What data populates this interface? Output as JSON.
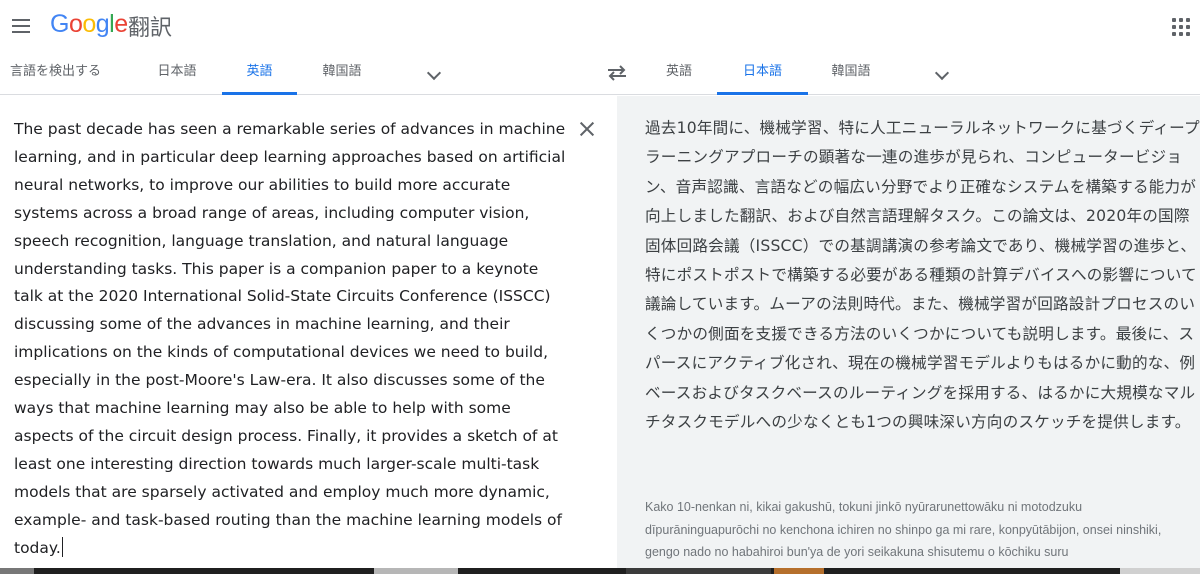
{
  "header": {
    "logo_parts": [
      "G",
      "o",
      "o",
      "g",
      "l",
      "e"
    ],
    "product_name": "翻訳",
    "menu_icon": "hamburger-menu-icon",
    "apps_icon": "apps-grid-icon"
  },
  "source_languages": {
    "detect": "言語を検出する",
    "tabs": [
      "日本語",
      "英語",
      "韓国語"
    ],
    "active": "英語"
  },
  "target_languages": {
    "tabs": [
      "英語",
      "日本語",
      "韓国語"
    ],
    "active": "日本語"
  },
  "icons": {
    "swap": "swap-languages-icon",
    "clear": "close-icon",
    "expand": "chevron-down-icon"
  },
  "colors": {
    "accent": "#1a73e8",
    "pane_bg": "#f1f3f4"
  },
  "source": {
    "text": "The past decade has seen a remarkable series of advances in machine learning, and in particular deep learning approaches based on artificial neural networks, to improve our abilities to build more accurate systems across a broad range of areas, including computer vision, speech recognition, language translation, and natural language understanding tasks. This paper is a companion paper to a keynote talk at the 2020 International Solid-State Circuits Conference (ISSCC) discussing some of the advances in machine learning, and their implications on the kinds of computational devices we need to build, especially in the post-Moore's Law-era. It also discusses some of the ways that machine learning may also be able to help with some aspects of the circuit design process. Finally, it provides a sketch of at least one interesting direction towards much larger-scale multi-task models that are sparsely activated and employ much more dynamic, example- and task-based routing than the machine learning models of today."
  },
  "translation": {
    "text": "過去10年間に、機械学習、特に人工ニューラルネットワークに基づくディープラーニングアプローチの顕著な一連の進歩が見られ、コンピュータービジョン、音声認識、言語などの幅広い分野でより正確なシステムを構築する能力が向上しました翻訳、および自然言語理解タスク。この論文は、2020年の国際固体回路会議（ISSCC）での基調講演の参考論文であり、機械学習の進歩と、特にポストポストで構築する必要がある種類の計算デバイスへの影響について議論しています。ムーアの法則時代。また、機械学習が回路設計プロセスのいくつかの側面を支援できる方法のいくつかについても説明します。最後に、スパースにアクティブ化され、現在の機械学習モデルよりもはるかに動的な、例ベースおよびタスクベースのルーティングを採用する、はるかに大規模なマルチタスクモデルへの少なくとも1つの興味深い方向のスケッチを提供します。",
    "romanization": "Kako 10-nenkan ni, kikai gakushū, tokuni jinkō nyūrarunettowāku ni motodzuku dīpurāninguapurōchi no kenchona ichiren no shinpo ga mi rare, konpyūtābijon, onsei ninshiki, gengo nado no habahiroi bun'ya de yori seikakuna shisutemu o kōchiku suru"
  }
}
